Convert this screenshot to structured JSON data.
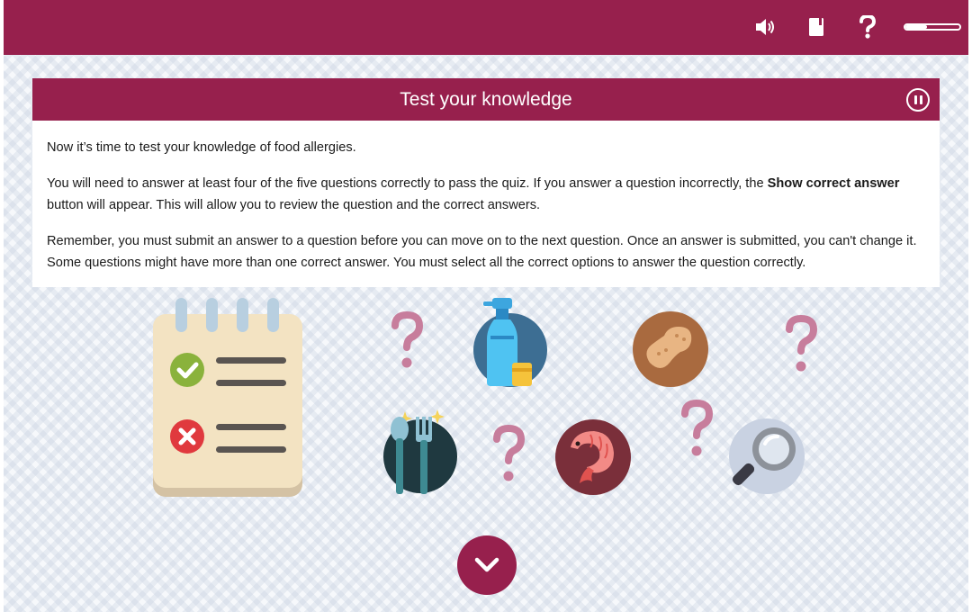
{
  "toolbar": {
    "audio_icon": "speaker-icon",
    "glossary_icon": "book-icon",
    "help_icon": "question-mark-icon",
    "progress_fraction": 0.4
  },
  "header": {
    "title": "Test your knowledge",
    "pause_icon": "pause-icon"
  },
  "content": {
    "para1": "Now it’s time to test your knowledge of food allergies.",
    "para2_before": "You will need to answer at least four of the five questions correctly to pass the quiz. If you answer a question incorrectly, the ",
    "para2_bold": "Show correct answer",
    "para2_after": " button will appear. This will allow you to review the question and the correct answers.",
    "para3": "Remember, you must submit an answer to a question before you can move on to the next question. Once an answer is submitted, you can't change it. Some questions might have more than one correct answer. You must select all the correct options to answer the question correctly."
  },
  "illustration": {
    "question_mark": "?",
    "icons": [
      "notepad-checklist-icon",
      "spray-bottle-sponge-icon",
      "peanut-icon",
      "cutlery-icon",
      "shrimp-icon",
      "magnifying-glass-icon"
    ]
  },
  "colors": {
    "brand": "#97204d",
    "question_mark": "#c77d9c"
  },
  "scroll_icon": "chevron-down-icon"
}
